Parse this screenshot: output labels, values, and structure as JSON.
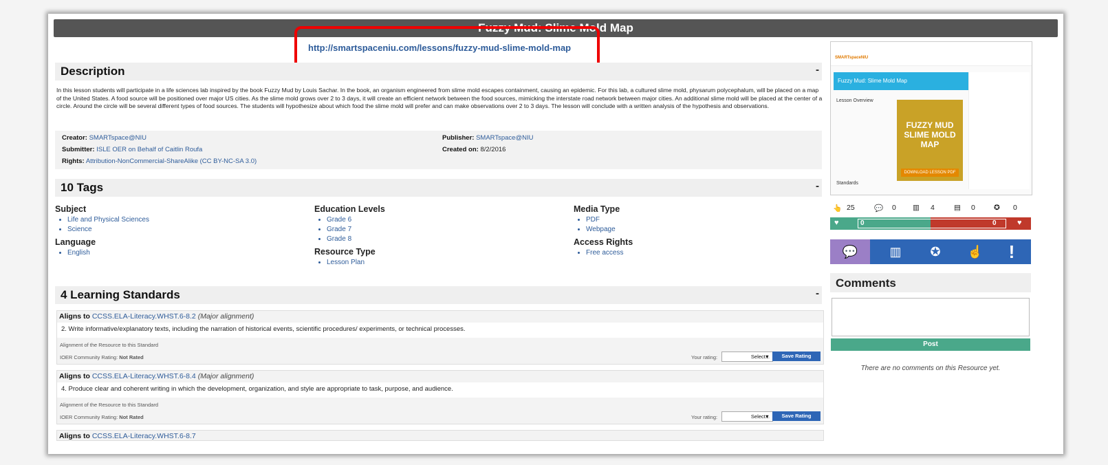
{
  "page": {
    "title": "Fuzzy Mud: Slime Mold Map",
    "url": "http://smartspaceniu.com/lessons/fuzzy-mud-slime-mold-map"
  },
  "description": {
    "heading": "Description",
    "toggle": "-",
    "text": "In this lesson students will participate in a life sciences lab inspired by the book Fuzzy Mud by Louis Sachar. In the book, an organism engineered from slime mold escapes containment, causing an epidemic. For this lab, a cultured slime mold, physarum polycephalum, will be placed on a map of the United States. A food source will be positioned over major US cities. As the slime mold grows over 2 to 3 days, it will create an efficient network between the food sources, mimicking the interstate road network between major cities. An additional slime mold will be placed at the center of a circle. Around the circle will be several different types of food sources. The students will hypothesize about which food the slime mold will prefer and can make observations over 2 to 3 days. The lesson will conclude with a written analysis of the hypothesis and observations."
  },
  "meta": {
    "creator_label": "Creator:",
    "creator": "SMARTspace@NIU",
    "submitter_label": "Submitter:",
    "submitter": "ISLE OER on Behalf of Caitlin Roufa",
    "rights_label": "Rights:",
    "rights": "Attribution-NonCommercial-ShareAlike (CC BY-NC-SA 3.0)",
    "publisher_label": "Publisher:",
    "publisher": "SMARTspace@NIU",
    "created_label": "Created on:",
    "created": "8/2/2016"
  },
  "tags": {
    "heading": "10  Tags",
    "toggle": "-",
    "subject": {
      "label": "Subject",
      "items": [
        "Life and Physical Sciences",
        "Science"
      ]
    },
    "language": {
      "label": "Language",
      "items": [
        "English"
      ]
    },
    "education": {
      "label": "Education Levels",
      "items": [
        "Grade 6",
        "Grade 7",
        "Grade 8"
      ]
    },
    "resource_type": {
      "label": "Resource Type",
      "items": [
        "Lesson Plan"
      ]
    },
    "media": {
      "label": "Media Type",
      "items": [
        "PDF",
        "Webpage"
      ]
    },
    "access": {
      "label": "Access Rights",
      "items": [
        "Free access"
      ]
    }
  },
  "standards": {
    "heading": "4   Learning Standards",
    "toggle": "-",
    "aligns_label": "Aligns to",
    "alignment_label": "Alignment of the Resource to this Standard",
    "community_label": "IOER Community Rating:",
    "your_rating_label": "Your rating:",
    "select_placeholder": "Select...",
    "save_label": "Save Rating",
    "items": [
      {
        "code": "CCSS.ELA-Literacy.WHST.6-8.2",
        "alignment": "(Major alignment)",
        "text": "2. Write informative/explanatory texts, including the narration of historical events, scientific procedures/ experiments, or technical processes.",
        "rating": "Not Rated"
      },
      {
        "code": "CCSS.ELA-Literacy.WHST.6-8.4",
        "alignment": "(Major alignment)",
        "text": "4. Produce clear and coherent writing in which the development, organization, and style are appropriate to task, purpose, and audience.",
        "rating": "Not Rated"
      },
      {
        "code": "CCSS.ELA-Literacy.WHST.6-8.7"
      }
    ]
  },
  "thumbnail": {
    "banner": "Fuzzy Mud: Slime Mold Map",
    "overview": "Lesson Overview",
    "cover_title": "FUZZY MUD SLIME MOLD MAP",
    "cover_button": "DOWNLOAD LESSON PDF",
    "standards": "Standards",
    "logo": "SMARTspaceNIU"
  },
  "stats": {
    "views": "25",
    "comments": "0",
    "libraries": "4",
    "downloads": "0",
    "awards": "0"
  },
  "likes": {
    "likes": "0",
    "dislikes": "0"
  },
  "comments": {
    "heading": "Comments",
    "post_label": "Post",
    "empty": "There are no comments on this Resource yet."
  },
  "colors": {
    "accent": "#2e5c9a",
    "highlight": "#e00000",
    "green": "#4aa88a",
    "red": "#c0392b",
    "purple": "#9b7fc6",
    "blue": "#2e66b6"
  }
}
